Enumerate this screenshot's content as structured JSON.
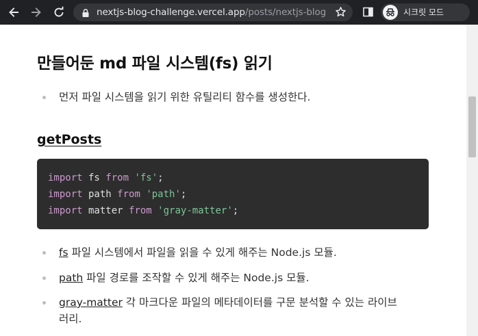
{
  "browser": {
    "url_host": "nextjs-blog-challenge.vercel.app",
    "url_path": "/posts/nextjs-blog",
    "incognito_label": "시크릿 모드",
    "icons": {
      "back": "back-arrow-icon",
      "forward": "forward-arrow-icon",
      "reload": "reload-icon",
      "lock": "lock-icon",
      "bookmark": "star-icon",
      "side_panel": "side-panel-icon",
      "incognito": "incognito-icon"
    }
  },
  "article": {
    "section_heading": "만들어둔 md 파일 시스템(fs) 읽기",
    "intro_bullet": "먼저 파일 시스템을 읽기 위한 유틸리티 함수를 생성한다.",
    "sub_heading": "getPosts",
    "code": {
      "lines": [
        [
          {
            "k": "import",
            "t": "kw"
          },
          {
            "k": " fs ",
            "t": "pl"
          },
          {
            "k": "from",
            "t": "kw"
          },
          {
            "k": " ",
            "t": "pl"
          },
          {
            "k": "'fs'",
            "t": "str"
          },
          {
            "k": ";",
            "t": "pl"
          }
        ],
        [
          {
            "k": "import",
            "t": "kw"
          },
          {
            "k": " path ",
            "t": "pl"
          },
          {
            "k": "from",
            "t": "kw"
          },
          {
            "k": " ",
            "t": "pl"
          },
          {
            "k": "'path'",
            "t": "str"
          },
          {
            "k": ";",
            "t": "pl"
          }
        ],
        [
          {
            "k": "import",
            "t": "kw"
          },
          {
            "k": " matter ",
            "t": "pl"
          },
          {
            "k": "from",
            "t": "kw"
          },
          {
            "k": " ",
            "t": "pl"
          },
          {
            "k": "'gray-matter'",
            "t": "str"
          },
          {
            "k": ";",
            "t": "pl"
          }
        ]
      ]
    },
    "module_bullets": [
      {
        "link": "fs",
        "text": " 파일 시스템에서 파일을 읽을 수 있게 해주는 Node.js 모듈."
      },
      {
        "link": "path",
        "text": " 파일 경로를 조작할 수 있게 해주는 Node.js 모듈."
      },
      {
        "link": "gray-matter",
        "text": " 각 마크다운 파일의 메타데이터를 구문 분석할 수 있는 라이브"
      }
    ],
    "module_bullet_wrap": "러리."
  },
  "colors": {
    "toolbar_bg": "#202124",
    "code_bg": "#2d2d2d",
    "keyword": "#cc99cd",
    "string": "#7ec699"
  }
}
